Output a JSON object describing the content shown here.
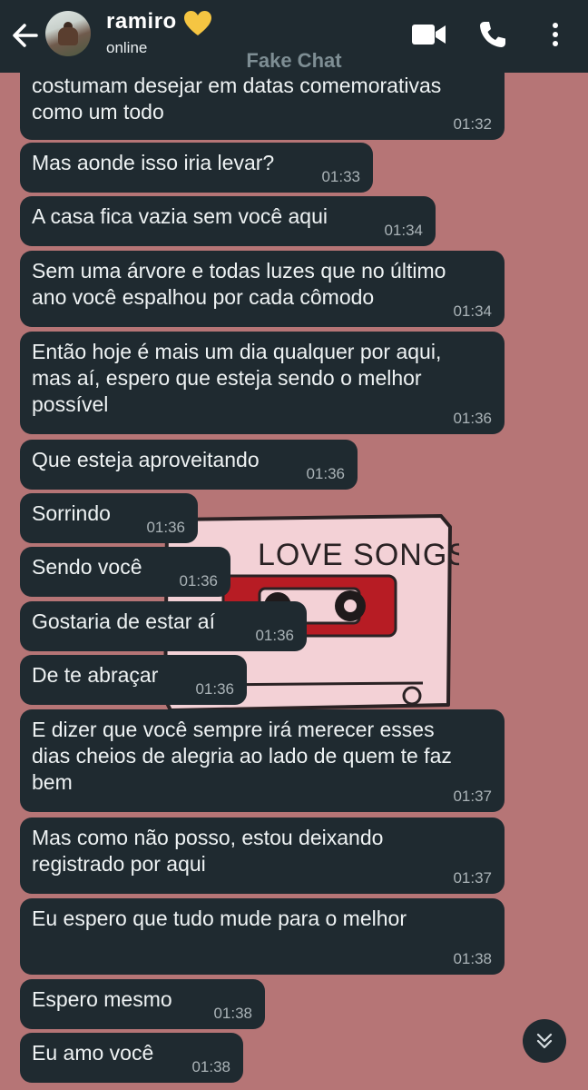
{
  "header": {
    "contact_name": "ramiro",
    "status": "online",
    "watermark": "Fake Chat"
  },
  "icons": {
    "back": "arrow-left-icon",
    "heart": "yellow-heart-icon",
    "video": "video-call-icon",
    "call": "phone-icon",
    "menu": "more-vertical-icon",
    "scroll": "chevron-double-down-icon"
  },
  "colors": {
    "background": "#b67576",
    "bubble": "#1f2a30",
    "header": "#1f2a30",
    "heart": "#f5c542"
  },
  "background_art_text": "LOVE SONGS",
  "messages": [
    {
      "text": "costumam desejar em datas comemorativas\ncomo um todo",
      "time": "01:32"
    },
    {
      "text": "Mas aonde isso iria levar?",
      "time": "01:33"
    },
    {
      "text": "A casa fica vazia sem você aqui",
      "time": "01:34"
    },
    {
      "text": "Sem uma árvore e todas luzes que no último\nano você espalhou por cada cômodo",
      "time": "01:34"
    },
    {
      "text": "Então hoje é mais um dia qualquer por aqui,\nmas aí, espero que esteja sendo o melhor\npossível",
      "time": "01:36"
    },
    {
      "text": "Que esteja aproveitando",
      "time": "01:36"
    },
    {
      "text": "Sorrindo",
      "time": "01:36"
    },
    {
      "text": "Sendo você",
      "time": "01:36"
    },
    {
      "text": "Gostaria de estar aí",
      "time": "01:36"
    },
    {
      "text": "De te abraçar",
      "time": "01:36"
    },
    {
      "text": "E dizer que você sempre irá merecer esses\ndias cheios de alegria ao lado de quem te faz\nbem",
      "time": "01:37"
    },
    {
      "text": "Mas como não posso, estou deixando\nregistrado por aqui",
      "time": "01:37"
    },
    {
      "text": "Eu espero que tudo mude para o melhor",
      "time": "01:38"
    },
    {
      "text": "Espero mesmo",
      "time": "01:38"
    },
    {
      "text": "Eu amo você",
      "time": "01:38"
    }
  ]
}
